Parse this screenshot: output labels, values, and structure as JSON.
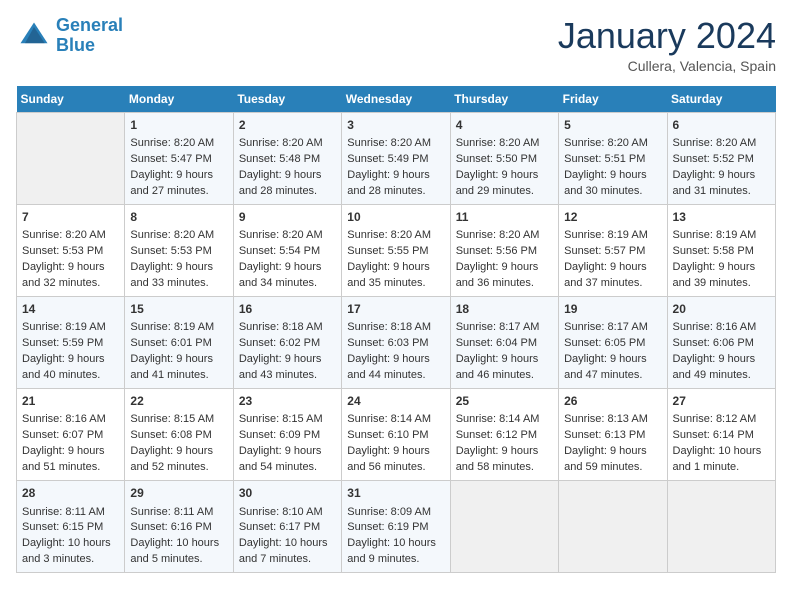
{
  "header": {
    "logo_line1": "General",
    "logo_line2": "Blue",
    "month": "January 2024",
    "location": "Cullera, Valencia, Spain"
  },
  "weekdays": [
    "Sunday",
    "Monday",
    "Tuesday",
    "Wednesday",
    "Thursday",
    "Friday",
    "Saturday"
  ],
  "weeks": [
    [
      {
        "day": "",
        "sunrise": "",
        "sunset": "",
        "daylight": ""
      },
      {
        "day": "1",
        "sunrise": "Sunrise: 8:20 AM",
        "sunset": "Sunset: 5:47 PM",
        "daylight": "Daylight: 9 hours and 27 minutes."
      },
      {
        "day": "2",
        "sunrise": "Sunrise: 8:20 AM",
        "sunset": "Sunset: 5:48 PM",
        "daylight": "Daylight: 9 hours and 28 minutes."
      },
      {
        "day": "3",
        "sunrise": "Sunrise: 8:20 AM",
        "sunset": "Sunset: 5:49 PM",
        "daylight": "Daylight: 9 hours and 28 minutes."
      },
      {
        "day": "4",
        "sunrise": "Sunrise: 8:20 AM",
        "sunset": "Sunset: 5:50 PM",
        "daylight": "Daylight: 9 hours and 29 minutes."
      },
      {
        "day": "5",
        "sunrise": "Sunrise: 8:20 AM",
        "sunset": "Sunset: 5:51 PM",
        "daylight": "Daylight: 9 hours and 30 minutes."
      },
      {
        "day": "6",
        "sunrise": "Sunrise: 8:20 AM",
        "sunset": "Sunset: 5:52 PM",
        "daylight": "Daylight: 9 hours and 31 minutes."
      }
    ],
    [
      {
        "day": "7",
        "sunrise": "Sunrise: 8:20 AM",
        "sunset": "Sunset: 5:53 PM",
        "daylight": "Daylight: 9 hours and 32 minutes."
      },
      {
        "day": "8",
        "sunrise": "Sunrise: 8:20 AM",
        "sunset": "Sunset: 5:53 PM",
        "daylight": "Daylight: 9 hours and 33 minutes."
      },
      {
        "day": "9",
        "sunrise": "Sunrise: 8:20 AM",
        "sunset": "Sunset: 5:54 PM",
        "daylight": "Daylight: 9 hours and 34 minutes."
      },
      {
        "day": "10",
        "sunrise": "Sunrise: 8:20 AM",
        "sunset": "Sunset: 5:55 PM",
        "daylight": "Daylight: 9 hours and 35 minutes."
      },
      {
        "day": "11",
        "sunrise": "Sunrise: 8:20 AM",
        "sunset": "Sunset: 5:56 PM",
        "daylight": "Daylight: 9 hours and 36 minutes."
      },
      {
        "day": "12",
        "sunrise": "Sunrise: 8:19 AM",
        "sunset": "Sunset: 5:57 PM",
        "daylight": "Daylight: 9 hours and 37 minutes."
      },
      {
        "day": "13",
        "sunrise": "Sunrise: 8:19 AM",
        "sunset": "Sunset: 5:58 PM",
        "daylight": "Daylight: 9 hours and 39 minutes."
      }
    ],
    [
      {
        "day": "14",
        "sunrise": "Sunrise: 8:19 AM",
        "sunset": "Sunset: 5:59 PM",
        "daylight": "Daylight: 9 hours and 40 minutes."
      },
      {
        "day": "15",
        "sunrise": "Sunrise: 8:19 AM",
        "sunset": "Sunset: 6:01 PM",
        "daylight": "Daylight: 9 hours and 41 minutes."
      },
      {
        "day": "16",
        "sunrise": "Sunrise: 8:18 AM",
        "sunset": "Sunset: 6:02 PM",
        "daylight": "Daylight: 9 hours and 43 minutes."
      },
      {
        "day": "17",
        "sunrise": "Sunrise: 8:18 AM",
        "sunset": "Sunset: 6:03 PM",
        "daylight": "Daylight: 9 hours and 44 minutes."
      },
      {
        "day": "18",
        "sunrise": "Sunrise: 8:17 AM",
        "sunset": "Sunset: 6:04 PM",
        "daylight": "Daylight: 9 hours and 46 minutes."
      },
      {
        "day": "19",
        "sunrise": "Sunrise: 8:17 AM",
        "sunset": "Sunset: 6:05 PM",
        "daylight": "Daylight: 9 hours and 47 minutes."
      },
      {
        "day": "20",
        "sunrise": "Sunrise: 8:16 AM",
        "sunset": "Sunset: 6:06 PM",
        "daylight": "Daylight: 9 hours and 49 minutes."
      }
    ],
    [
      {
        "day": "21",
        "sunrise": "Sunrise: 8:16 AM",
        "sunset": "Sunset: 6:07 PM",
        "daylight": "Daylight: 9 hours and 51 minutes."
      },
      {
        "day": "22",
        "sunrise": "Sunrise: 8:15 AM",
        "sunset": "Sunset: 6:08 PM",
        "daylight": "Daylight: 9 hours and 52 minutes."
      },
      {
        "day": "23",
        "sunrise": "Sunrise: 8:15 AM",
        "sunset": "Sunset: 6:09 PM",
        "daylight": "Daylight: 9 hours and 54 minutes."
      },
      {
        "day": "24",
        "sunrise": "Sunrise: 8:14 AM",
        "sunset": "Sunset: 6:10 PM",
        "daylight": "Daylight: 9 hours and 56 minutes."
      },
      {
        "day": "25",
        "sunrise": "Sunrise: 8:14 AM",
        "sunset": "Sunset: 6:12 PM",
        "daylight": "Daylight: 9 hours and 58 minutes."
      },
      {
        "day": "26",
        "sunrise": "Sunrise: 8:13 AM",
        "sunset": "Sunset: 6:13 PM",
        "daylight": "Daylight: 9 hours and 59 minutes."
      },
      {
        "day": "27",
        "sunrise": "Sunrise: 8:12 AM",
        "sunset": "Sunset: 6:14 PM",
        "daylight": "Daylight: 10 hours and 1 minute."
      }
    ],
    [
      {
        "day": "28",
        "sunrise": "Sunrise: 8:11 AM",
        "sunset": "Sunset: 6:15 PM",
        "daylight": "Daylight: 10 hours and 3 minutes."
      },
      {
        "day": "29",
        "sunrise": "Sunrise: 8:11 AM",
        "sunset": "Sunset: 6:16 PM",
        "daylight": "Daylight: 10 hours and 5 minutes."
      },
      {
        "day": "30",
        "sunrise": "Sunrise: 8:10 AM",
        "sunset": "Sunset: 6:17 PM",
        "daylight": "Daylight: 10 hours and 7 minutes."
      },
      {
        "day": "31",
        "sunrise": "Sunrise: 8:09 AM",
        "sunset": "Sunset: 6:19 PM",
        "daylight": "Daylight: 10 hours and 9 minutes."
      },
      {
        "day": "",
        "sunrise": "",
        "sunset": "",
        "daylight": ""
      },
      {
        "day": "",
        "sunrise": "",
        "sunset": "",
        "daylight": ""
      },
      {
        "day": "",
        "sunrise": "",
        "sunset": "",
        "daylight": ""
      }
    ]
  ]
}
